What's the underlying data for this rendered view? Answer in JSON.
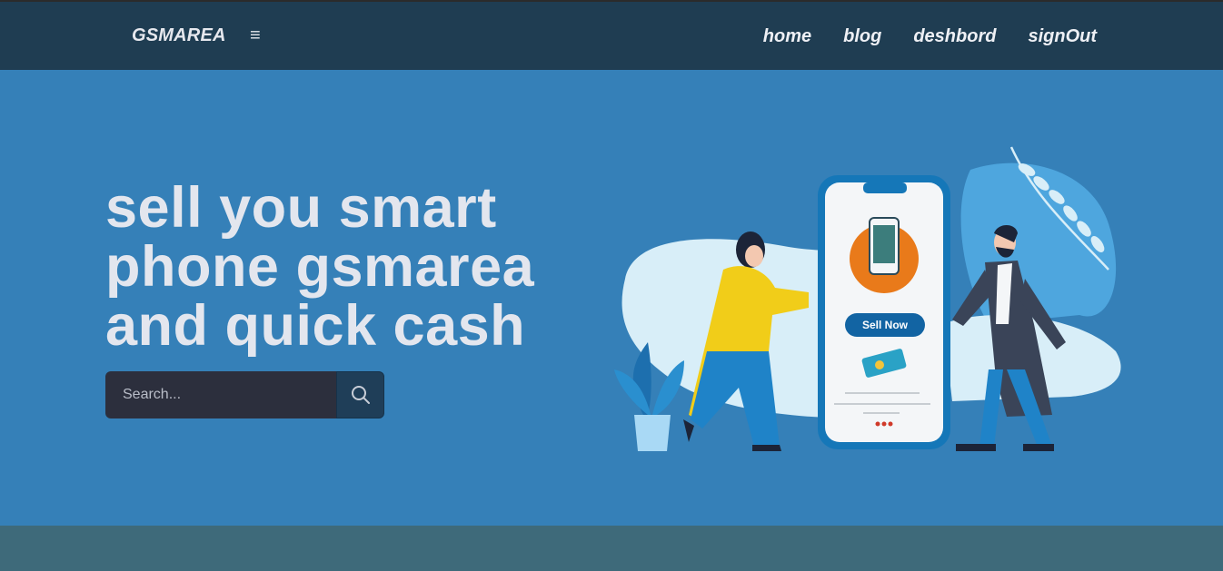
{
  "navbar": {
    "brand": "GSMAREA",
    "menu_icon": "hamburger-icon",
    "menu_glyph": "≡",
    "links": [
      "home",
      "blog",
      "deshbord",
      "signOut"
    ]
  },
  "hero": {
    "title": "sell you smart phone gsmarea and quick cash",
    "search_placeholder": "Search...",
    "search_icon": "search-icon",
    "illustration": {
      "button_label": "Sell Now"
    }
  },
  "colors": {
    "navbar_bg": "#1f3d52",
    "hero_bg": "#3580b8",
    "footer_bg": "#3e6a7a",
    "search_bg": "#2c2f3d",
    "search_button_bg": "#1f3e58"
  }
}
